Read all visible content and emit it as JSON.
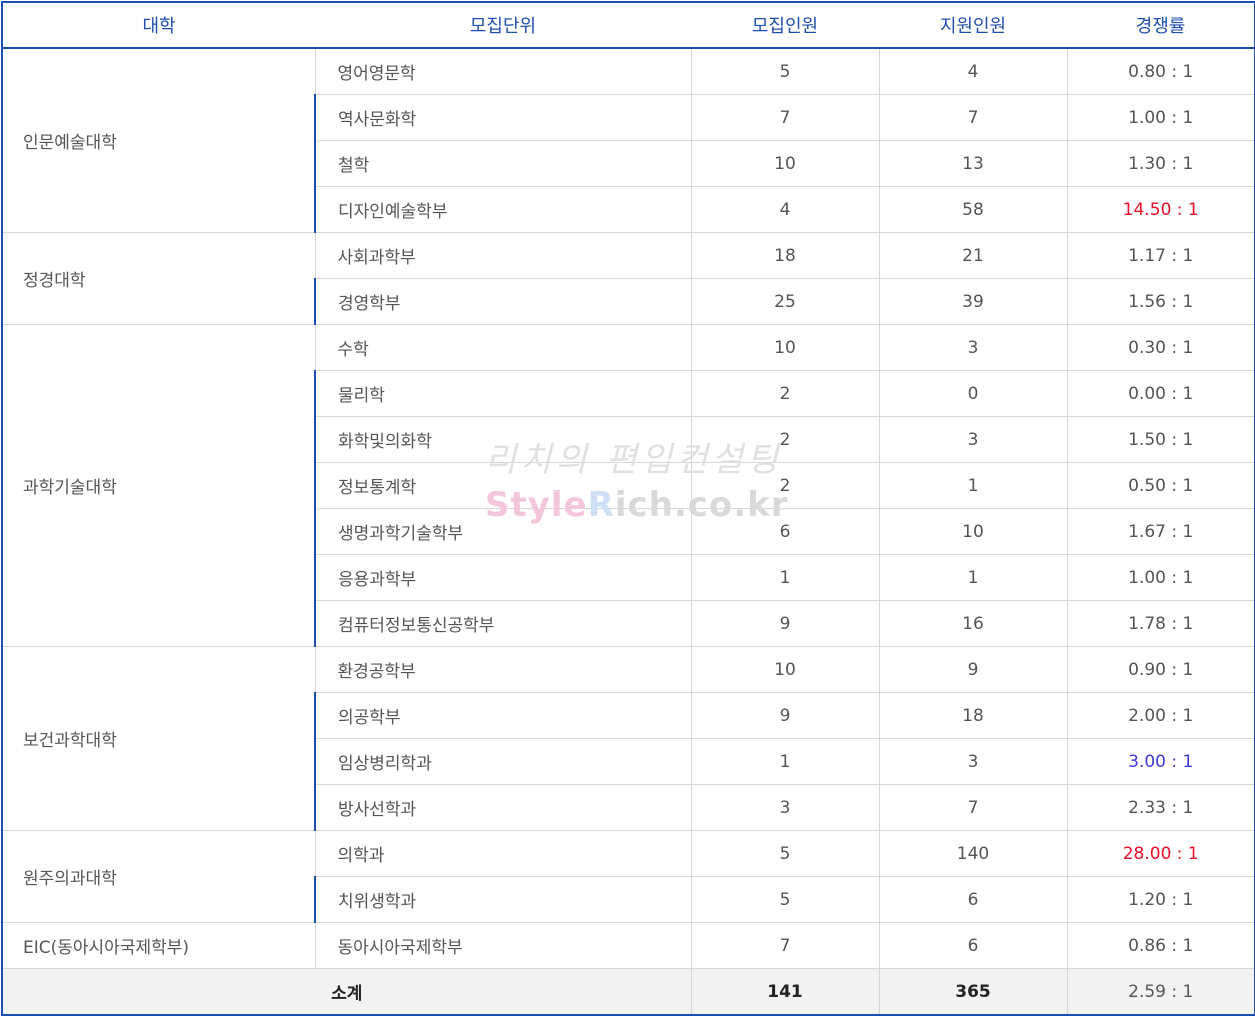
{
  "headers": [
    "대학",
    "모집단위",
    "모집인원",
    "지원인원",
    "경쟁률"
  ],
  "groups": [
    {
      "college": "인문예술대학",
      "rows": [
        {
          "unit": "영어영문학",
          "quota": "5",
          "applicants": "4",
          "rate": "0.80 : 1"
        },
        {
          "unit": "역사문화학",
          "quota": "7",
          "applicants": "7",
          "rate": "1.00 : 1"
        },
        {
          "unit": "철학",
          "quota": "10",
          "applicants": "13",
          "rate": "1.30 : 1"
        },
        {
          "unit": "디자인예술학부",
          "quota": "4",
          "applicants": "58",
          "rate": "14.50 : 1",
          "highlight": "red"
        }
      ]
    },
    {
      "college": "정경대학",
      "rows": [
        {
          "unit": "사회과학부",
          "quota": "18",
          "applicants": "21",
          "rate": "1.17 : 1"
        },
        {
          "unit": "경영학부",
          "quota": "25",
          "applicants": "39",
          "rate": "1.56 : 1"
        }
      ]
    },
    {
      "college": "과학기술대학",
      "rows": [
        {
          "unit": "수학",
          "quota": "10",
          "applicants": "3",
          "rate": "0.30 : 1"
        },
        {
          "unit": "물리학",
          "quota": "2",
          "applicants": "0",
          "rate": "0.00 : 1"
        },
        {
          "unit": "화학및의화학",
          "quota": "2",
          "applicants": "3",
          "rate": "1.50 : 1"
        },
        {
          "unit": "정보통계학",
          "quota": "2",
          "applicants": "1",
          "rate": "0.50 : 1"
        },
        {
          "unit": "생명과학기술학부",
          "quota": "6",
          "applicants": "10",
          "rate": "1.67 : 1"
        },
        {
          "unit": "응용과학부",
          "quota": "1",
          "applicants": "1",
          "rate": "1.00 : 1"
        },
        {
          "unit": "컴퓨터정보통신공학부",
          "quota": "9",
          "applicants": "16",
          "rate": "1.78 : 1"
        }
      ]
    },
    {
      "college": "보건과학대학",
      "rows": [
        {
          "unit": "환경공학부",
          "quota": "10",
          "applicants": "9",
          "rate": "0.90 : 1"
        },
        {
          "unit": "의공학부",
          "quota": "9",
          "applicants": "18",
          "rate": "2.00 : 1"
        },
        {
          "unit": "임상병리학과",
          "quota": "1",
          "applicants": "3",
          "rate": "3.00 : 1",
          "highlight": "blue"
        },
        {
          "unit": "방사선학과",
          "quota": "3",
          "applicants": "7",
          "rate": "2.33 : 1"
        }
      ]
    },
    {
      "college": "원주의과대학",
      "rows": [
        {
          "unit": "의학과",
          "quota": "5",
          "applicants": "140",
          "rate": "28.00 : 1",
          "highlight": "red"
        },
        {
          "unit": "치위생학과",
          "quota": "5",
          "applicants": "6",
          "rate": "1.20 : 1"
        }
      ]
    },
    {
      "college": "EIC(동아시아국제학부)",
      "rows": [
        {
          "unit": "동아시아국제학부",
          "quota": "7",
          "applicants": "6",
          "rate": "0.86 : 1"
        }
      ]
    }
  ],
  "total": {
    "label": "소계",
    "quota": "141",
    "applicants": "365",
    "rate": "2.59 : 1"
  },
  "watermark": {
    "line1": "리치의 편입컨설팅",
    "line2_a": "Style",
    "line2_b": "R",
    "line2_c": "ich.co.kr"
  },
  "colors": {
    "header_border": "#1a4fb4",
    "header_text": "#1f4eac",
    "highlight_red": "#e8102a",
    "highlight_blue": "#3b3bd6"
  }
}
